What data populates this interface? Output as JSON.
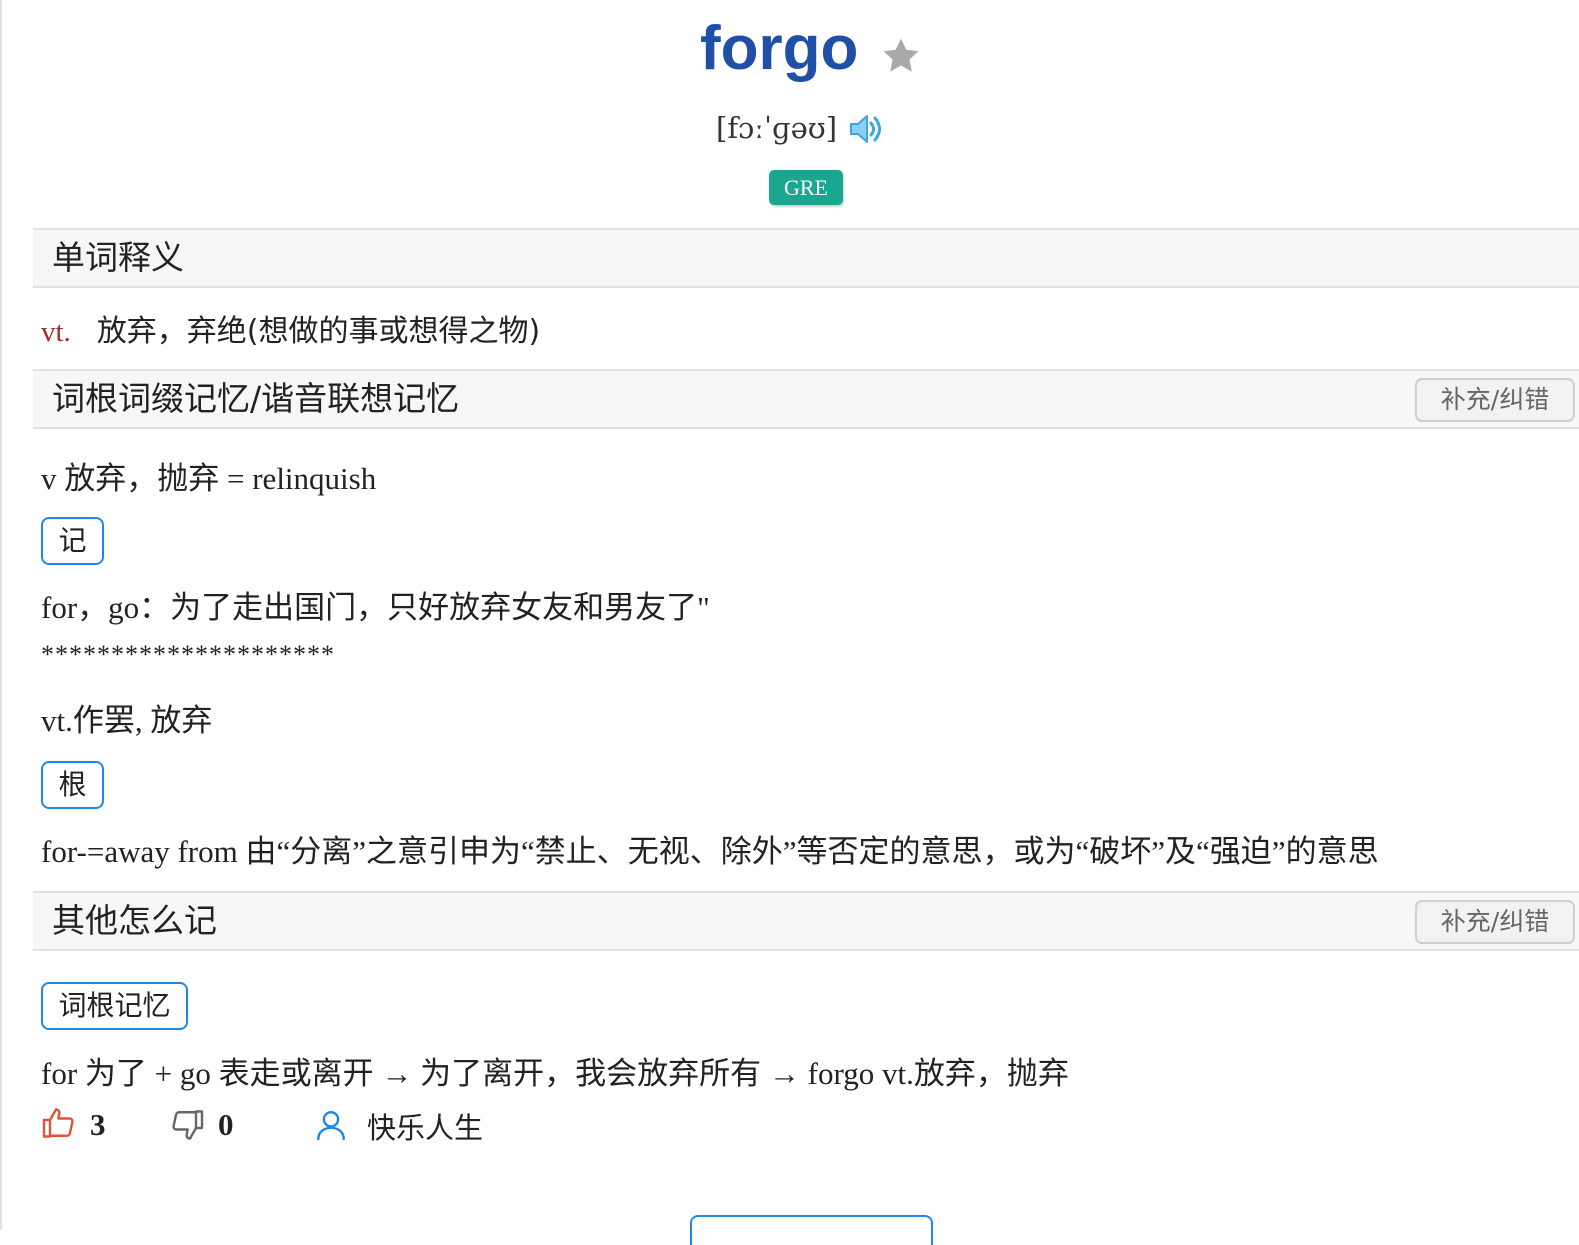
{
  "word": {
    "headword": "forgo",
    "phonetic": "[fɔːˈɡəʊ]",
    "tag": "GRE"
  },
  "definition_section": {
    "title": "单词释义",
    "pos": "vt.",
    "meaning": "放弃，弃绝(想做的事或想得之物)"
  },
  "mnemonic_section": {
    "title": "词根词缀记忆/谐音联想记忆",
    "fix_label": "补充/纠错",
    "line1": "v 放弃，抛弃 = relinquish",
    "badge_ji": "记",
    "line2": "for，go：为了走出国门，只好放弃女友和男友了\"",
    "stars": "*********************",
    "line3": "vt.作罢, 放弃",
    "badge_gen": "根",
    "line4": "for-=away from 由“分离”之意引申为“禁止、无视、除外”等否定的意思，或为“破坏”及“强迫”的意思"
  },
  "other_section": {
    "title": "其他怎么记",
    "fix_label": "补充/纠错",
    "badge": "词根记忆",
    "line": "for 为了 + go 表走或离开 → 为了离开，我会放弃所有 → forgo vt.放弃，抛弃",
    "likes": "3",
    "dislikes": "0",
    "author": "快乐人生"
  },
  "colors": {
    "headword": "#1f4fa7",
    "tag_bg": "#1ba68f",
    "pos": "#9b2d2d",
    "badge_border": "#1e88e5",
    "like_icon": "#e0533a",
    "speaker": "#3aa6e6"
  },
  "icons": {
    "star": "star-icon",
    "speaker": "speaker-icon",
    "like": "thumbs-up-icon",
    "dislike": "thumbs-down-icon",
    "user": "user-icon"
  }
}
